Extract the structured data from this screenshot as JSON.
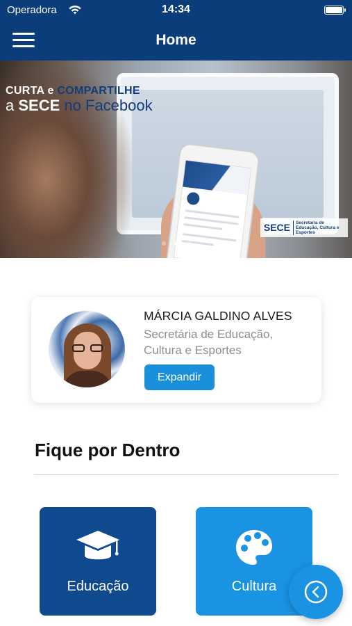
{
  "status_bar": {
    "carrier": "Operadora",
    "time": "14:34"
  },
  "nav": {
    "title": "Home"
  },
  "banner": {
    "line1_white": "CURTA e",
    "line1_blue": "COMPARTILHE",
    "line2_prefix": "a",
    "line2_bold": "SECE",
    "line2_suffix": "no Facebook",
    "logo_name": "SECE",
    "logo_text": "Secretaria de Educação, Cultura e Esportes",
    "slide_count": 3,
    "active_slide": 2
  },
  "profile": {
    "name": "MÁRCIA GALDINO ALVES",
    "role": "Secretária de Educação, Cultura e Esportes",
    "button_label": "Expandir"
  },
  "section": {
    "title": "Fique por Dentro"
  },
  "tiles": [
    {
      "label": "Educação",
      "icon": "graduation-cap-icon",
      "color": "#0e4a8d"
    },
    {
      "label": "Cultura",
      "icon": "palette-icon",
      "color": "#1993e2"
    }
  ],
  "colors": {
    "primary": "#0a3d7a",
    "accent": "#1993e2"
  },
  "fab": {
    "icon": "chevron-left-circle-icon"
  }
}
